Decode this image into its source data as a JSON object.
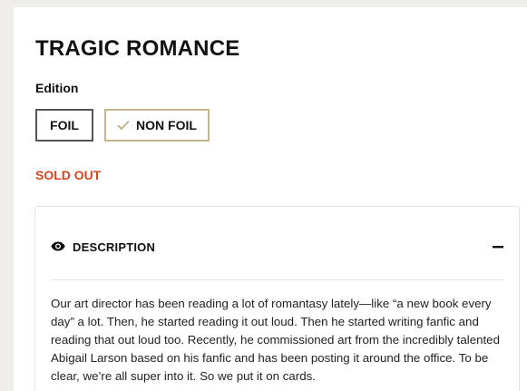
{
  "product": {
    "title": "TRAGIC ROMANCE",
    "edition_label": "Edition",
    "editions": [
      {
        "label": "FOIL",
        "selected": false
      },
      {
        "label": "NON FOIL",
        "selected": true
      }
    ],
    "status": "SOLD OUT"
  },
  "description": {
    "heading": "DESCRIPTION",
    "expanded": true,
    "icon": "eye-icon",
    "toggle_icon": "minus-icon",
    "text": "Our art director has been reading a lot of romantasy lately—like “a new book every day” a lot. Then, he started reading it out loud. Then he started writing fanfic and reading that out loud too. Recently, he commissioned art from the incredibly talented Abigail Larson based on his fanfic and has been posting it around the office. To be clear, we’re all super into it. So we put it on cards."
  },
  "colors": {
    "accent_border": "#c7b48a",
    "sold_out": "#d4451f",
    "background": "#efeeec"
  }
}
